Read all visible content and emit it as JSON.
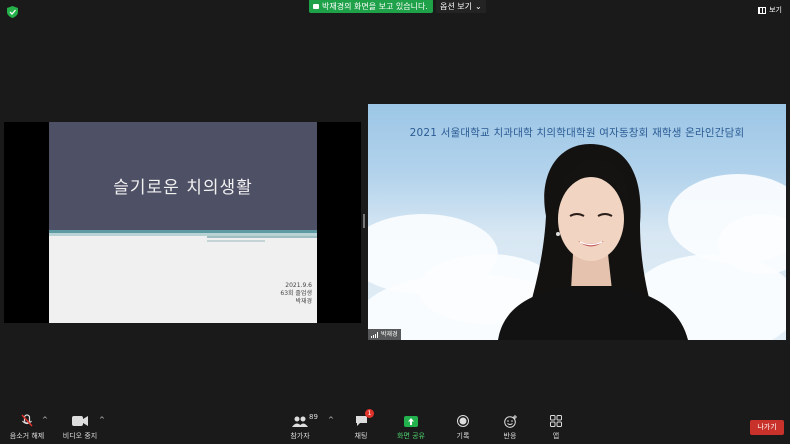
{
  "top_bar": {
    "share_banner": "박재경의 화면을 보고 있습니다.",
    "view_options": "옵션 보기",
    "view_button": "보기"
  },
  "slide": {
    "title": "슬기로운 치의생활",
    "date": "2021.9.6",
    "class": "63회 졸업생",
    "name": "박재경"
  },
  "video": {
    "banner": "2021 서울대학교 치과대학 치의학대학원 여자동창회 재학생 온라인간담회",
    "name_tag": "박재경"
  },
  "toolbar": {
    "mute": "음소거 해제",
    "video_stop": "비디오 중지",
    "participants": "참가자",
    "participants_count": "89",
    "chat": "채팅",
    "chat_badge": "1",
    "share": "화면 공유",
    "record": "기록",
    "reactions": "반응",
    "apps": "앱",
    "leave": "나가기"
  },
  "colors": {
    "share_green": "#1fa14a",
    "leave_red": "#c9322a",
    "slide_band": "#4e5065",
    "banner_text": "#2b5b93"
  }
}
